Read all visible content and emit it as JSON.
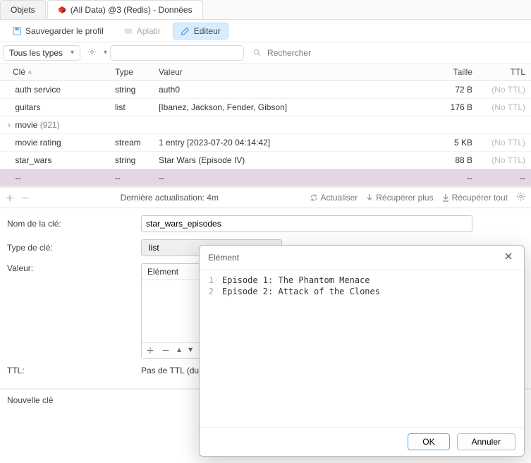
{
  "tabs": {
    "objects": "Objets",
    "active": "(All Data) @3 (Redis) - Données"
  },
  "toolbar": {
    "save": "Sauvegarder le profil",
    "flatten": "Aplatir",
    "editor": "Editeur"
  },
  "filter": {
    "all_types": "Tous les types",
    "search_placeholder": "Rechercher"
  },
  "columns": {
    "key": "Clé",
    "type": "Type",
    "value": "Valeur",
    "size": "Taille",
    "ttl": "TTL"
  },
  "rows": [
    {
      "key": "auth service",
      "type": "string",
      "value": "auth0",
      "size": "72 B",
      "ttl": "(No TTL)"
    },
    {
      "key": "guitars",
      "type": "list",
      "value": "[Ibanez, Jackson, Fender, Gibson]",
      "size": "176 B",
      "ttl": "(No TTL)"
    },
    {
      "key": "movie",
      "count": "(921)",
      "type": "",
      "value": "",
      "size": "",
      "ttl": "",
      "expandable": true
    },
    {
      "key": "movie rating",
      "type": "stream",
      "value": "1 entry [2023-07-20 04:14:42]",
      "size": "5 KB",
      "ttl": "(No TTL)"
    },
    {
      "key": "star_wars",
      "type": "string",
      "value": "Star Wars (Episode IV)",
      "size": "88 B",
      "ttl": "(No TTL)"
    },
    {
      "key": "--",
      "type": "--",
      "value": "--",
      "size": "--",
      "ttl": "--",
      "selected": true
    }
  ],
  "actionbar": {
    "last_update": "Dernière actualisation: 4m",
    "refresh": "Actualiser",
    "fetch_more": "Récupérer plus",
    "fetch_all": "Récupérer tout"
  },
  "form": {
    "key_label": "Nom de la clé:",
    "key_value": "star_wars_episodes",
    "type_label": "Type de clé:",
    "type_value": "list",
    "value_label": "Valeur:",
    "value_header": "Elément",
    "ttl_label": "TTL:",
    "ttl_text": "Pas de TTL (durée de vie infinie)"
  },
  "footer": {
    "new_key": "Nouvelle clé"
  },
  "modal": {
    "title": "Elément",
    "lines": [
      {
        "n": "1",
        "t": "Episode 1: The Phantom Menace"
      },
      {
        "n": "2",
        "t": "Episode 2: Attack of the Clones"
      }
    ],
    "ok": "OK",
    "cancel": "Annuler"
  }
}
